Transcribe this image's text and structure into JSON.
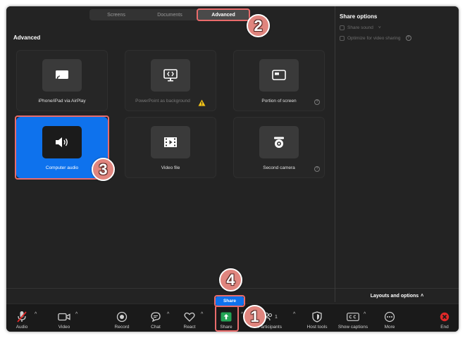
{
  "tabs": [
    {
      "label": "Screens",
      "active": false
    },
    {
      "label": "Documents",
      "active": false
    },
    {
      "label": "Advanced",
      "active": true
    }
  ],
  "section_title": "Advanced",
  "tiles": [
    {
      "label": "iPhone/iPad via AirPlay",
      "icon": "airplay-icon",
      "state": "normal"
    },
    {
      "label": "PowerPoint as background",
      "icon": "powerpoint-icon",
      "state": "dimmed",
      "warning": true
    },
    {
      "label": "Portion of screen",
      "icon": "portion-of-screen-icon",
      "state": "normal",
      "help": "?"
    },
    {
      "label": "Computer audio",
      "icon": "speaker-icon",
      "state": "selected"
    },
    {
      "label": "Video file",
      "icon": "film-icon",
      "state": "normal"
    },
    {
      "label": "Second camera",
      "icon": "camera-icon",
      "state": "normal",
      "help": "?"
    }
  ],
  "side": {
    "title": "Share options",
    "options": [
      {
        "label": "Share sound",
        "suffix": "˅"
      },
      {
        "label": "Optimize for video sharing",
        "help": "?"
      }
    ]
  },
  "share_button": "Share",
  "layouts_label": "Layouts and options",
  "layouts_caret": "˄",
  "toolbar": {
    "audio": "Audio",
    "video": "Video",
    "record": "Record",
    "chat": "Chat",
    "react": "React",
    "share": "Share",
    "participants": "Participants",
    "participants_count": "1",
    "host_tools": "Host tools",
    "show_captions": "Show captions",
    "more": "More",
    "end": "End",
    "caret": "^"
  },
  "badges": [
    "1",
    "2",
    "3",
    "4"
  ],
  "colors": {
    "accent_blue": "#0e72ed",
    "share_green": "#23a455",
    "end_red": "#e02828",
    "highlight": "#e96b6b",
    "badge_fill": "#e0857e"
  }
}
